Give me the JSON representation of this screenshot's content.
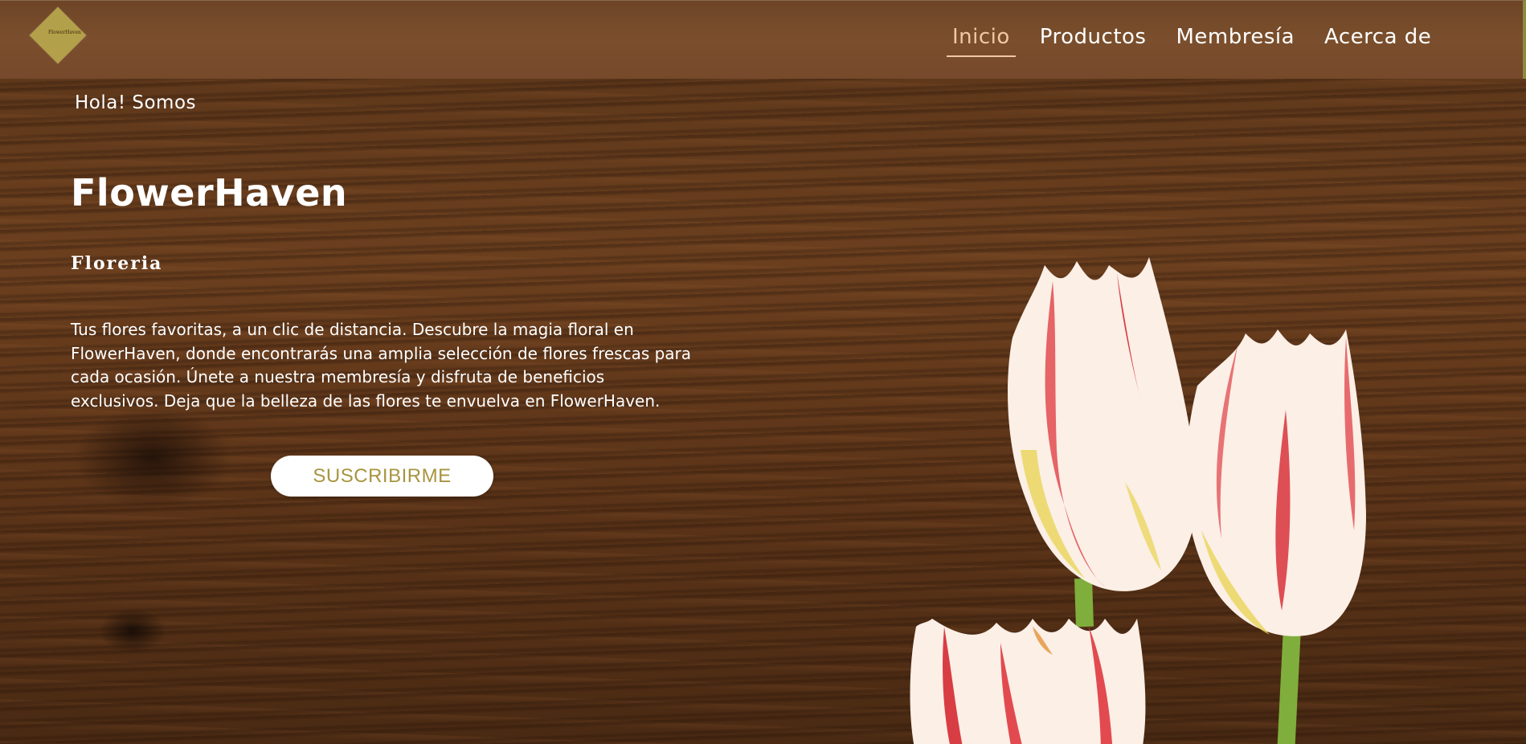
{
  "header": {
    "logo_text": "FlowerHaven",
    "nav": [
      {
        "label": "Inicio",
        "active": true
      },
      {
        "label": "Productos",
        "active": false
      },
      {
        "label": "Membresía",
        "active": false
      },
      {
        "label": "Acerca de",
        "active": false
      }
    ]
  },
  "hero": {
    "greeting": "Hola! Somos",
    "brand": "FlowerHaven",
    "tagline": "Floreria",
    "description": "Tus flores favoritas, a un clic de distancia. Descubre la magia floral en FlowerHaven, donde encontrarás una amplia selección de flores frescas para cada ocasión. Únete a nuestra membresía y disfruta de beneficios exclusivos. Deja que la belleza de las flores te envuelva en FlowerHaven.",
    "cta_label": "SUSCRIBIRME"
  },
  "colors": {
    "nav_active": "#efc8a4",
    "logo_gold": "#b3a04a",
    "cta_text": "#a89440",
    "navbar_bg": "#7b4f2d"
  },
  "icons": {
    "logo": "diamond-logo-icon",
    "hero_image": "tulip-flowers-image"
  }
}
